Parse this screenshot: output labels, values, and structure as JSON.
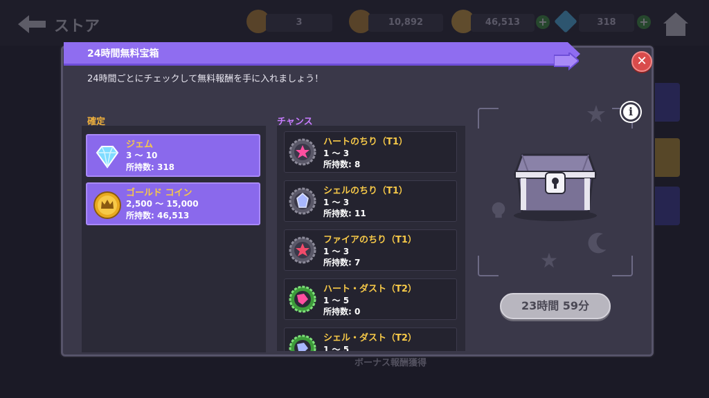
{
  "store": {
    "title": "ストア",
    "resources": [
      {
        "name": "energy",
        "value": "3",
        "color": "#e0a93a"
      },
      {
        "name": "crown-token",
        "value": "10,892",
        "color": "#e0a93a"
      },
      {
        "name": "gold-coin",
        "value": "46,513",
        "color": "#e0a93a"
      },
      {
        "name": "gem",
        "value": "318",
        "color": "#4fc3f7"
      }
    ],
    "bonus_label": "ボーナス報酬獲得",
    "badge_count": "1"
  },
  "dialog": {
    "title": "24時間無料宝箱",
    "subtitle": "24時間ごとにチェックして無料報酬を手に入れましょう！",
    "close_icon": "close-icon",
    "sure_label": "確定",
    "chance_label": "チャンス",
    "sure_items": [
      {
        "icon": "gem-icon",
        "name": "ジェム",
        "range": "3 ～ 10",
        "owned": "所持数: 318"
      },
      {
        "icon": "gold-coin-icon",
        "name": "ゴールド コイン",
        "range": "2,500 ～ 15,000",
        "owned": "所持数: 46,513"
      }
    ],
    "chance_items": [
      {
        "icon": "heart-dust-icon",
        "name": "ハートのちり（T1）",
        "range": "1 ～ 3",
        "owned": "所持数: 8"
      },
      {
        "icon": "shell-dust-icon",
        "name": "シェルのちり（T1）",
        "range": "1 ～ 3",
        "owned": "所持数: 11"
      },
      {
        "icon": "fire-dust-icon",
        "name": "ファイアのちり（T1）",
        "range": "1 ～ 3",
        "owned": "所持数: 7"
      },
      {
        "icon": "heart-dust-t2-icon",
        "name": "ハート・ダスト（T2）",
        "range": "1 ～ 5",
        "owned": "所持数: 0"
      },
      {
        "icon": "shell-dust-t2-icon",
        "name": "シェル・ダスト（T2）",
        "range": "1 ～ 5",
        "owned": ""
      }
    ],
    "timer": "23時間 59分",
    "info_symbol": "i"
  },
  "colors": {
    "accent_purple": "#8f6df0",
    "sure_label": "#f0b13c",
    "chance_label": "#c87cff",
    "item_name": "#f7c948",
    "close_red": "#d94b4b"
  }
}
